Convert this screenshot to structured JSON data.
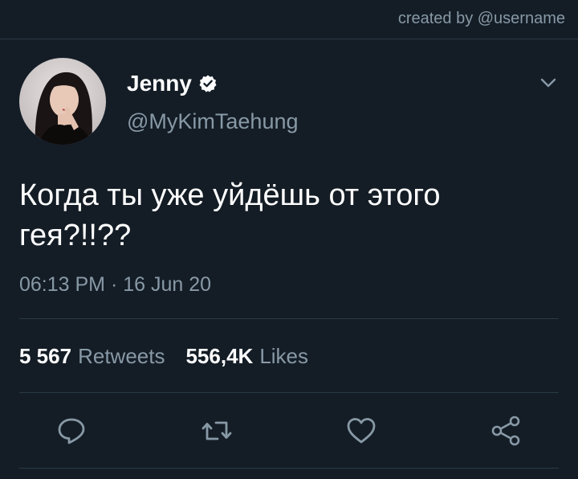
{
  "watermark": "created by @username",
  "author": {
    "display_name": "Jenny",
    "handle": "@MyKimTaehung",
    "verified": true
  },
  "tweet": {
    "text": "Когда ты уже уйдёшь от этого гея?!!??",
    "timestamp": "06:13 PM · 16 Jun 20"
  },
  "stats": {
    "retweets_count": "5 567",
    "retweets_label": "Retweets",
    "likes_count": "556,4K",
    "likes_label": "Likes"
  },
  "actions": {
    "reply_icon": "reply-icon",
    "retweet_icon": "retweet-icon",
    "like_icon": "heart-icon",
    "share_icon": "share-icon"
  },
  "colors": {
    "background": "#141d26",
    "secondary_text": "#8899a6",
    "divider": "#2b3a47"
  }
}
